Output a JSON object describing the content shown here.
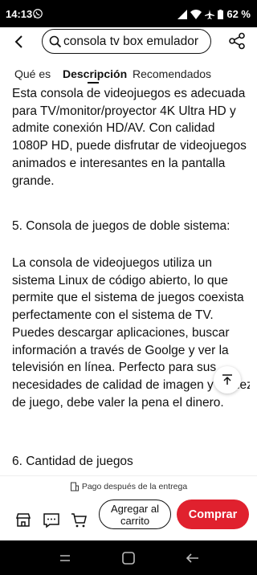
{
  "status": {
    "time": "14:13",
    "battery": "62 %"
  },
  "search": {
    "query": "consola tv box emulador"
  },
  "tabs": [
    {
      "label": "Qué es"
    },
    {
      "label": "Descripción"
    },
    {
      "label": "Recomendados"
    }
  ],
  "content": {
    "paragraph1": "Esta consola de videojuegos es adecuada para TV/monitor/proyector 4K Ultra HD y admite conexión HD/AV. Con calidad 1080P HD, puede disfrutar de videojuegos animados e interesantes en la pantalla grande.",
    "heading5": "5. Consola de juegos de doble sistema:",
    "paragraph2": "La consola de videojuegos utiliza un sistema Linux de código abierto, lo que permite que el sistema de juegos coexista perfectamente con el sistema de TV. Puedes descargar aplicaciones, buscar información a través de Goolge y ver la televisión en línea. Perfecto para sus necesidades de calidad de imagen y fluidez de juego, debe valer la pena el dinero.",
    "heading6": "6. Cantidad de juegos"
  },
  "bottom": {
    "payment_note": "Pago después de la entrega",
    "add_to_cart": "Agregar al carrito",
    "buy": "Comprar"
  },
  "colors": {
    "accent": "#e0212e"
  }
}
